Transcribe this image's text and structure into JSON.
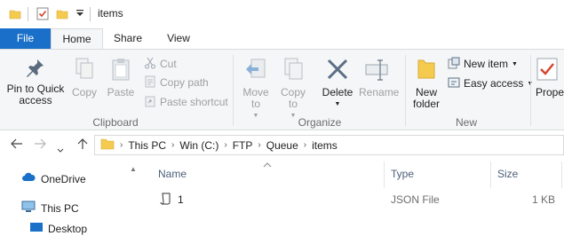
{
  "window": {
    "title": "items"
  },
  "tabs": {
    "file": "File",
    "home": "Home",
    "share": "Share",
    "view": "View"
  },
  "ribbon": {
    "pin_label": "Pin to Quick access",
    "copy_label": "Copy",
    "paste_label": "Paste",
    "cut_label": "Cut",
    "copy_path_label": "Copy path",
    "paste_shortcut_label": "Paste shortcut",
    "clipboard_group": "Clipboard",
    "move_to_label": "Move to",
    "copy_to_label": "Copy to",
    "delete_label": "Delete",
    "rename_label": "Rename",
    "organize_group": "Organize",
    "new_folder_label": "New folder",
    "new_item_label": "New item",
    "easy_access_label": "Easy access",
    "new_group": "New",
    "properties_label": "Prope"
  },
  "address": {
    "crumbs": [
      "This PC",
      "Win (C:)",
      "FTP",
      "Queue",
      "items"
    ]
  },
  "nav_pane": {
    "items": [
      "OneDrive",
      "This PC",
      "Desktop"
    ]
  },
  "file_list": {
    "columns": {
      "name": "Name",
      "type": "Type",
      "size": "Size"
    },
    "rows": [
      {
        "name": "1",
        "type": "JSON File",
        "size": "1 KB"
      }
    ]
  },
  "colors": {
    "accent": "#1a6fc9",
    "folder": "#f5cb4f"
  }
}
